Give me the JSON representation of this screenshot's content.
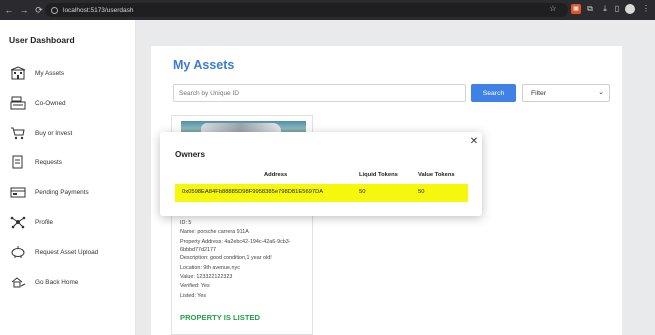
{
  "browser": {
    "url": "localhost:5173/userdash"
  },
  "sidebar": {
    "title": "User Dashboard",
    "items": [
      {
        "label": "My Assets",
        "icon": "building-icon"
      },
      {
        "label": "Co-Owned",
        "icon": "cash-register-icon"
      },
      {
        "label": "Buy or Invest",
        "icon": "cart-icon"
      },
      {
        "label": "Requests",
        "icon": "document-icon"
      },
      {
        "label": "Pending Payments",
        "icon": "payment-icon"
      },
      {
        "label": "Profile",
        "icon": "profile-network-icon"
      },
      {
        "label": "Request Asset Upload",
        "icon": "piggy-bank-icon"
      },
      {
        "label": "Go Back Home",
        "icon": "hand-home-icon"
      }
    ]
  },
  "main": {
    "title": "My Assets",
    "search": {
      "placeholder": "Search by Unique ID",
      "button_label": "Search"
    },
    "filter": {
      "selected": "Filter"
    }
  },
  "asset": {
    "details": [
      "ID: 5",
      "Name: porsche carrera 911A",
      "Property Address: 4a2ebc42-194c-42a6-9cb3-6bbbd77d2177",
      "Description: good condition,1 year old!",
      "Location: 9th avenue,nyc",
      "Value: 123322122323",
      "Verified: Yes",
      "Listed: Yes"
    ],
    "status": "PROPERTY IS LISTED"
  },
  "modal": {
    "title": "Owners",
    "columns": [
      "Address",
      "Liquid Tokens",
      "Value Tokens"
    ],
    "rows": [
      {
        "address": "0x0598EA84Fb88885D98F9958385e798D81E5697DA",
        "liquid_tokens": "50",
        "value_tokens": "50"
      }
    ]
  },
  "colors": {
    "accent": "#3a7bd5",
    "button": "#3e82e6",
    "highlight": "#f5f70c",
    "listed": "#22a14a"
  }
}
